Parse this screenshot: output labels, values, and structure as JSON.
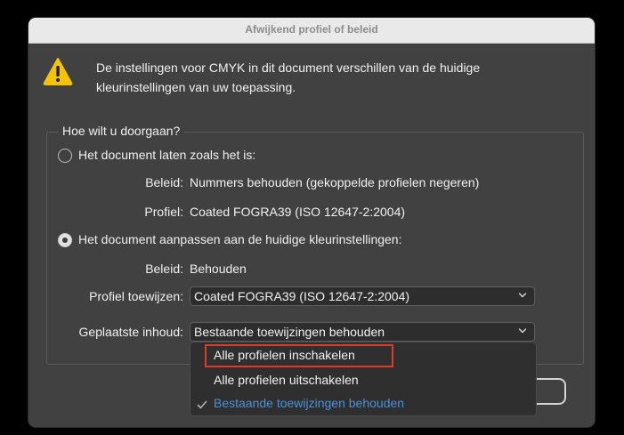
{
  "dialog": {
    "title": "Afwijkend profiel of beleid",
    "message_line1": "De instellingen voor CMYK in dit document verschillen van de huidige",
    "message_line2": "kleurinstellingen van uw toepassing.",
    "icon": "warning-icon"
  },
  "group": {
    "legend": "Hoe wilt u doorgaan?",
    "option1": {
      "label": "Het document laten zoals het is:",
      "selected": false,
      "policy_label": "Beleid:",
      "policy_value": "Nummers behouden (gekoppelde profielen negeren)",
      "profile_label": "Profiel:",
      "profile_value": "Coated FOGRA39 (ISO 12647-2:2004)"
    },
    "option2": {
      "label": "Het document aanpassen aan de huidige kleurinstellingen:",
      "selected": true,
      "policy_label": "Beleid:",
      "policy_value": "Behouden",
      "assign_label": "Profiel toewijzen:",
      "assign_value": "Coated FOGRA39 (ISO 12647-2:2004)",
      "placed_label": "Geplaatste inhoud:",
      "placed_value": "Bestaande toewijzingen behouden"
    }
  },
  "dropdown": {
    "items": [
      "Alle profielen inschakelen",
      "Alle profielen uitschakelen",
      "Bestaande toewijzingen behouden"
    ],
    "selected_index": 2,
    "highlighted_index": 0
  },
  "colors": {
    "dialog_bg": "#414141",
    "selected_item": "#4a90d9",
    "highlight_box": "#e03a2a",
    "warning_yellow": "#f5c400"
  }
}
